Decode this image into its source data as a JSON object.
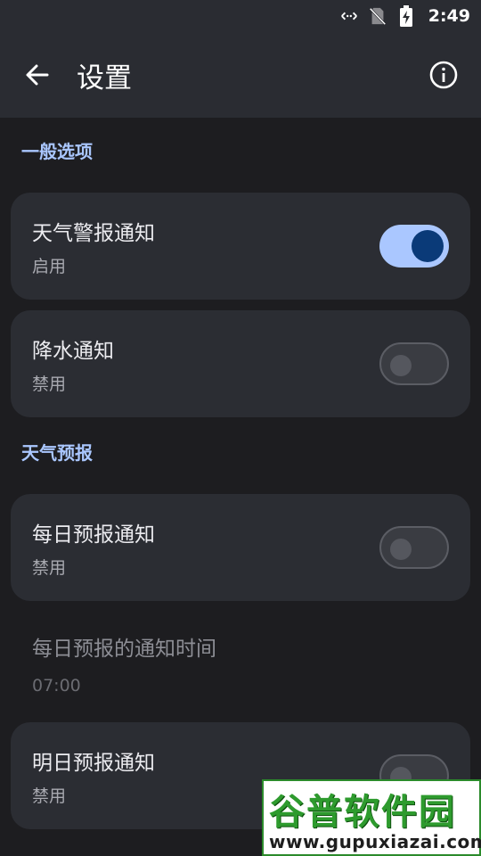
{
  "status_bar": {
    "time": "2:49",
    "icons": [
      "data-arrows-icon",
      "no-sim-icon",
      "battery-charging-icon"
    ]
  },
  "app_bar": {
    "title": "设置",
    "back_icon": "arrow-left-icon",
    "info_icon": "info-icon"
  },
  "sections": [
    {
      "header": "一般选项",
      "items": [
        {
          "title": "天气警报通知",
          "subtitle": "启用",
          "switch_on": true
        },
        {
          "title": "降水通知",
          "subtitle": "禁用",
          "switch_on": false
        }
      ]
    },
    {
      "header": "天气预报",
      "items": [
        {
          "title": "每日预报通知",
          "subtitle": "禁用",
          "switch_on": false
        },
        {
          "title": "每日预报的通知时间",
          "subtitle": "07:00",
          "disabled": true
        },
        {
          "title": "明日预报通知",
          "subtitle": "禁用",
          "switch_on": false
        }
      ]
    }
  ],
  "watermark": {
    "brand": "谷普软件园",
    "url": "www.gupuxiazai.com"
  },
  "colors": {
    "accent": "#aac7ff",
    "switch_knob_on": "#0a3a78",
    "card": "#2b2d33",
    "background": "#1d1d20"
  }
}
